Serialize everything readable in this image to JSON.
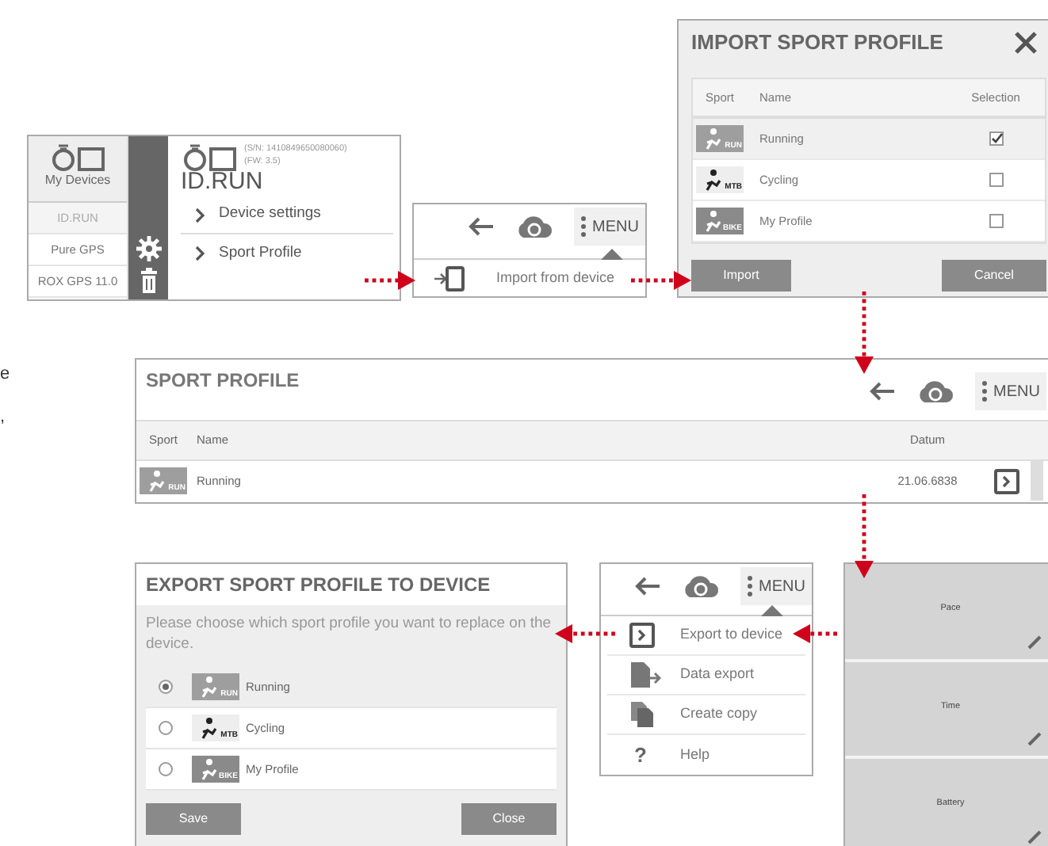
{
  "margin_text": [
    "e",
    ","
  ],
  "devices_panel": {
    "title": "My Devices",
    "devices": [
      {
        "name": "ID.RUN",
        "selected": true
      },
      {
        "name": "Pure GPS",
        "selected": false
      },
      {
        "name": "ROX GPS 11.0",
        "selected": false
      }
    ],
    "serial": "(S/N: 1410849650080060)",
    "firmware": "(FW: 3.5)",
    "device_name": "ID.RUN",
    "links": [
      "Device settings",
      "Sport Profile"
    ]
  },
  "import_menu": {
    "menu_label": "MENU",
    "items": [
      {
        "kind": "import",
        "label": "Import from device"
      }
    ]
  },
  "import_dialog": {
    "title": "IMPORT SPORT PROFILE",
    "columns": [
      "Sport",
      "Name",
      "Selection"
    ],
    "rows": [
      {
        "kind": "run",
        "badge": "RUN",
        "name": "Running",
        "checked": true,
        "selected": true
      },
      {
        "kind": "mtb",
        "badge": "MTB",
        "name": "Cycling",
        "checked": false,
        "selected": false
      },
      {
        "kind": "bike",
        "badge": "BIKE",
        "name": "My Profile",
        "checked": false,
        "selected": false
      }
    ],
    "buttons": [
      "Import",
      "Cancel"
    ]
  },
  "sport_profile": {
    "title": "SPORT PROFILE",
    "menu_label": "MENU",
    "columns": [
      "Sport",
      "Name",
      "Datum"
    ],
    "rows": [
      {
        "kind": "run",
        "badge": "RUN",
        "name": "Running",
        "date": "21.06.6838"
      }
    ]
  },
  "export_dialog": {
    "title": "EXPORT SPORT PROFILE TO DEVICE",
    "message": "Please choose which sport profile you want to replace on the device.",
    "options": [
      {
        "kind": "run",
        "badge": "RUN",
        "name": "Running",
        "selected": true
      },
      {
        "kind": "mtb",
        "badge": "MTB",
        "name": "Cycling",
        "selected": false
      },
      {
        "kind": "bike",
        "badge": "BIKE",
        "name": "My Profile",
        "selected": false
      }
    ],
    "buttons": [
      "Save",
      "Close"
    ]
  },
  "profile_menu": {
    "menu_label": "MENU",
    "items": [
      {
        "kind": "export",
        "label": "Export to device"
      },
      {
        "kind": "data_export",
        "label": "Data export"
      },
      {
        "kind": "copy",
        "label": "Create copy"
      },
      {
        "kind": "help",
        "label": "Help",
        "glyph": "?"
      }
    ]
  },
  "device_screen": {
    "fields": [
      "Pace",
      "Time",
      "Battery"
    ]
  }
}
